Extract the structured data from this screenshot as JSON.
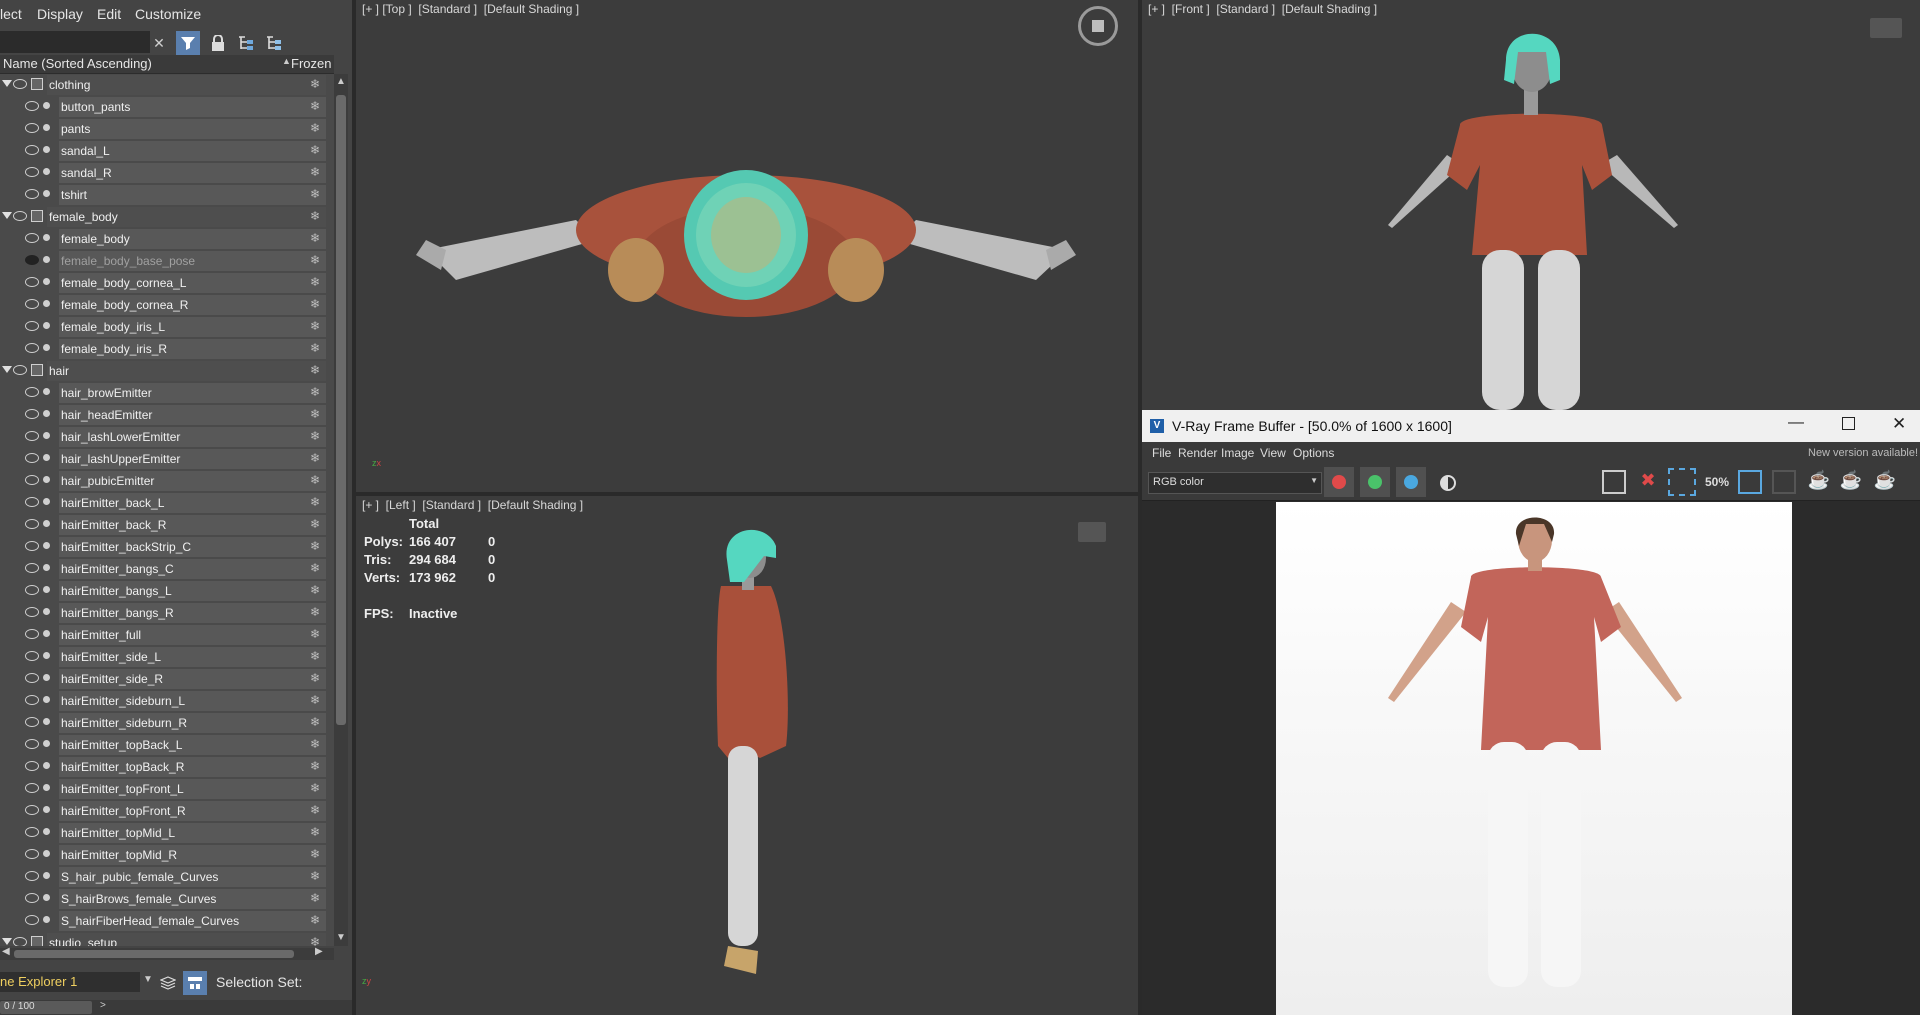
{
  "menu": {
    "items": [
      "lect",
      "Display",
      "Edit",
      "Customize"
    ]
  },
  "explorer": {
    "header_name": "Name (Sorted Ascending)",
    "header_frozen": "Frozen",
    "rows": [
      {
        "label": "clothing",
        "group": true
      },
      {
        "label": "button_pants"
      },
      {
        "label": "pants"
      },
      {
        "label": "sandal_L"
      },
      {
        "label": "sandal_R"
      },
      {
        "label": "tshirt"
      },
      {
        "label": "female_body",
        "group": true
      },
      {
        "label": "female_body"
      },
      {
        "label": "female_body_base_pose",
        "dim": true
      },
      {
        "label": "female_body_cornea_L"
      },
      {
        "label": "female_body_cornea_R"
      },
      {
        "label": "female_body_iris_L"
      },
      {
        "label": "female_body_iris_R"
      },
      {
        "label": "hair",
        "group": true
      },
      {
        "label": "hair_browEmitter"
      },
      {
        "label": "hair_headEmitter"
      },
      {
        "label": "hair_lashLowerEmitter"
      },
      {
        "label": "hair_lashUpperEmitter"
      },
      {
        "label": "hair_pubicEmitter"
      },
      {
        "label": "hairEmitter_back_L"
      },
      {
        "label": "hairEmitter_back_R"
      },
      {
        "label": "hairEmitter_backStrip_C"
      },
      {
        "label": "hairEmitter_bangs_C"
      },
      {
        "label": "hairEmitter_bangs_L"
      },
      {
        "label": "hairEmitter_bangs_R"
      },
      {
        "label": "hairEmitter_full"
      },
      {
        "label": "hairEmitter_side_L"
      },
      {
        "label": "hairEmitter_side_R"
      },
      {
        "label": "hairEmitter_sideburn_L"
      },
      {
        "label": "hairEmitter_sideburn_R"
      },
      {
        "label": "hairEmitter_topBack_L"
      },
      {
        "label": "hairEmitter_topBack_R"
      },
      {
        "label": "hairEmitter_topFront_L"
      },
      {
        "label": "hairEmitter_topFront_R"
      },
      {
        "label": "hairEmitter_topMid_L"
      },
      {
        "label": "hairEmitter_topMid_R"
      },
      {
        "label": "S_hair_pubic_female_Curves"
      },
      {
        "label": "S_hairBrows_female_Curves"
      },
      {
        "label": "S_hairFiberHead_female_Curves"
      },
      {
        "label": "studio_setup",
        "group": true
      }
    ],
    "explorer_name": "ne Explorer 1",
    "selection_set_label": "Selection Set:",
    "frame_counter": "0 / 100"
  },
  "viewports": {
    "top": {
      "label": "[+ ] [Top ]  [Standard ]  [Default Shading ]"
    },
    "front": {
      "label": "[+ ]  [Front ]  [Standard ]  [Default Shading ]"
    },
    "left": {
      "label": "[+ ]  [Left ]  [Standard ]  [Default Shading ]"
    }
  },
  "stats": {
    "total_label": "Total",
    "polys_label": "Polys:",
    "polys_value": "166 407",
    "polys_sel": "0",
    "tris_label": "Tris:",
    "tris_value": "294 684",
    "tris_sel": "0",
    "verts_label": "Verts:",
    "verts_value": "173 962",
    "verts_sel": "0",
    "fps_label": "FPS:",
    "fps_value": "Inactive"
  },
  "vray": {
    "title": "V-Ray Frame Buffer - [50.0% of 1600 x 1600]",
    "menu": [
      "File",
      "Render",
      "Image",
      "View",
      "Options"
    ],
    "new_version": "New version available!",
    "channel": "RGB color",
    "zoom_icon_text": "50%",
    "colors": {
      "red": "#e04a4a",
      "green": "#4ac26a",
      "blue": "#4aa8e0"
    }
  }
}
